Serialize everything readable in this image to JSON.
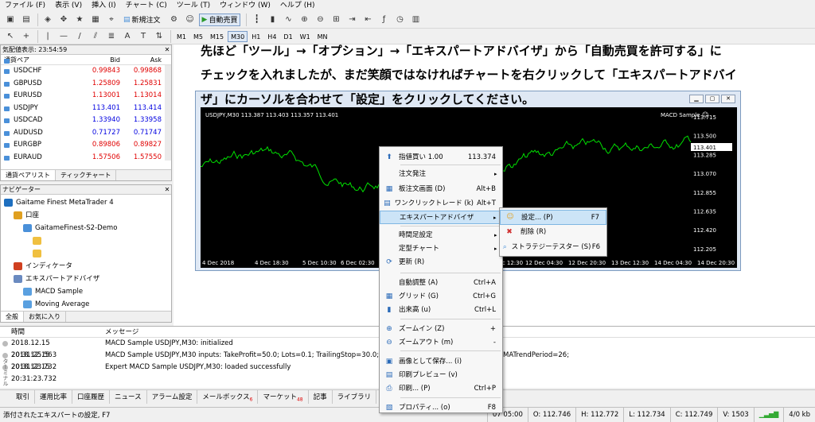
{
  "menubar": [
    "ファイル (F)",
    "表示 (V)",
    "挿入 (I)",
    "チャート (C)",
    "ツール (T)",
    "ウィンドウ (W)",
    "ヘルプ (H)"
  ],
  "toolbar": {
    "new_order": "新規注文",
    "auto_trading": "自動売買",
    "timeframes": [
      "M1",
      "M5",
      "M15",
      "M30",
      "H1",
      "H4",
      "D1",
      "W1",
      "MN"
    ],
    "active_timeframe": "M30"
  },
  "market_watch": {
    "title": "気配値表示: 23:54:59",
    "col_symbol": "通貨ペア",
    "col_bid": "Bid",
    "col_ask": "Ask",
    "rows": [
      {
        "symbol": "USDCHF",
        "bid": "0.99843",
        "ask": "0.99868",
        "color": "#e00000"
      },
      {
        "symbol": "GBPUSD",
        "bid": "1.25809",
        "ask": "1.25831",
        "color": "#e00000"
      },
      {
        "symbol": "EURUSD",
        "bid": "1.13001",
        "ask": "1.13014",
        "color": "#e00000"
      },
      {
        "symbol": "USDJPY",
        "bid": "113.401",
        "ask": "113.414",
        "color": "#0000e0"
      },
      {
        "symbol": "USDCAD",
        "bid": "1.33940",
        "ask": "1.33958",
        "color": "#0000e0"
      },
      {
        "symbol": "AUDUSD",
        "bid": "0.71727",
        "ask": "0.71747",
        "color": "#0000e0"
      },
      {
        "symbol": "EURGBP",
        "bid": "0.89806",
        "ask": "0.89827",
        "color": "#e00000"
      },
      {
        "symbol": "EURAUD",
        "bid": "1.57506",
        "ask": "1.57550",
        "color": "#e00000"
      }
    ],
    "tabs": [
      "通貨ペアリスト",
      "ティックチャート"
    ]
  },
  "navigator": {
    "title": "ナビゲーター",
    "items": [
      {
        "label": "Gaitame Finest MetaTrader 4",
        "indent": 0
      },
      {
        "label": "口座",
        "indent": 1
      },
      {
        "label": "GaitameFinest-S2-Demo",
        "indent": 2
      },
      {
        "label": "",
        "indent": 3
      },
      {
        "label": "",
        "indent": 3
      },
      {
        "label": "インディケータ",
        "indent": 1
      },
      {
        "label": "エキスパートアドバイザ",
        "indent": 1
      },
      {
        "label": "MACD Sample",
        "indent": 2
      },
      {
        "label": "Moving Average",
        "indent": 2
      },
      {
        "label": "スクリプト",
        "indent": 1
      }
    ],
    "tabs": [
      "全般",
      "お気に入り"
    ]
  },
  "instruction": {
    "line1": "先ほど「ツール」→「オプション」→「エキスパートアドバイザ」から「自動売買を許可する」に",
    "line2": "チェックを入れましたが、まだ笑顔ではなければチャートを右クリックして「エキスパートアドバイ",
    "line3": "ザ」にカーソルを合わせて「設定」をクリックしてください。"
  },
  "chart_window": {
    "info": "USDJPY,M30  113.387 113.403 113.357 113.401",
    "ea_label": "MACD Sample",
    "current_price": "113.401",
    "price_ticks": [
      "113.715",
      "113.500",
      "113.285",
      "113.070",
      "112.855",
      "112.635",
      "112.420",
      "112.205"
    ],
    "time_labels_left": [
      "4 Dec 2018",
      "4 Dec 18:30",
      "5 Dec 10:30",
      "6 Dec 02:30",
      "6 Dec 18:30"
    ],
    "time_labels_right": [
      "11 Dec 12:30",
      "12 Dec 04:30",
      "12 Dec 20:30",
      "13 Dec 12:30",
      "14 Dec 04:30",
      "14 Dec 20:30"
    ]
  },
  "context_menu": {
    "items": [
      {
        "label": "指値買い 1.00",
        "shortcut": "113.374",
        "icon": "up-arrow-icon"
      },
      {
        "label": "注文発注",
        "arrow": true
      },
      {
        "label": "板注文画面 (D)",
        "shortcut": "Alt+B",
        "icon": "board-icon"
      },
      {
        "label": "ワンクリックトレード (k)",
        "shortcut": "Alt+T",
        "icon": "oneclick-icon"
      },
      {
        "label": "エキスパートアドバイザ",
        "arrow": true,
        "highlight": true
      },
      {
        "label": "時間足設定",
        "arrow": true
      },
      {
        "label": "定型チャート",
        "arrow": true
      },
      {
        "label": "更新 (R)",
        "icon": "refresh-icon"
      },
      {
        "label": "自動調整 (A)",
        "shortcut": "Ctrl+A"
      },
      {
        "label": "グリッド (G)",
        "shortcut": "Ctrl+G",
        "icon": "grid-icon"
      },
      {
        "label": "出来高 (u)",
        "shortcut": "Ctrl+L",
        "icon": "volume-icon"
      },
      {
        "label": "ズームイン (Z)",
        "shortcut": "+",
        "icon": "zoom-in-icon"
      },
      {
        "label": "ズームアウト (m)",
        "shortcut": "-",
        "icon": "zoom-out-icon"
      },
      {
        "label": "画像として保存... (i)",
        "icon": "save-image-icon"
      },
      {
        "label": "印刷プレビュー (v)",
        "icon": "print-preview-icon"
      },
      {
        "label": "印刷... (P)",
        "shortcut": "Ctrl+P",
        "icon": "print-icon"
      },
      {
        "label": "プロパティ... (o)",
        "shortcut": "F8",
        "icon": "properties-icon"
      }
    ],
    "submenu": [
      {
        "label": "設定... (P)",
        "shortcut": "F7",
        "highlight": true
      },
      {
        "label": "削除 (R)",
        "shortcut": ""
      },
      {
        "label": "ストラテジーテスター (S)",
        "shortcut": "F6"
      }
    ]
  },
  "terminal": {
    "col_time": "時間",
    "col_message": "メッセージ",
    "rows": [
      {
        "time": "2018.12.15 20:31:25.563",
        "message": "MACD Sample USDJPY,M30: initialized"
      },
      {
        "time": "2018.12.15 20:31:23.732",
        "message": "MACD Sample USDJPY,M30 inputs: TakeProfit=50.0; Lots=0.1; TrailingStop=30.0; MACDO"
      },
      {
        "time": "2018.12.15 20:31:23.732",
        "message": "Expert MACD Sample USDJPY,M30: loaded successfully"
      }
    ],
    "row2_tail": "MATrendPeriod=26;",
    "tabs": [
      "取引",
      "運用比率",
      "口座履歴",
      "ニュース",
      "アラーム設定",
      "メールボックス",
      "マーケット",
      "記事",
      "ライブラリ",
      "エキス"
    ],
    "mailbox_badge": "6",
    "market_badge": "48",
    "side_label": "ターミナル"
  },
  "statusbar": {
    "message": "添付されたエキスパートの設定, F7",
    "datetime": "07 05:00",
    "open": "O: 112.746",
    "high": "H: 112.772",
    "low": "L: 112.734",
    "close": "C: 112.749",
    "volume": "V: 1503",
    "traffic": "4/0 kb"
  }
}
